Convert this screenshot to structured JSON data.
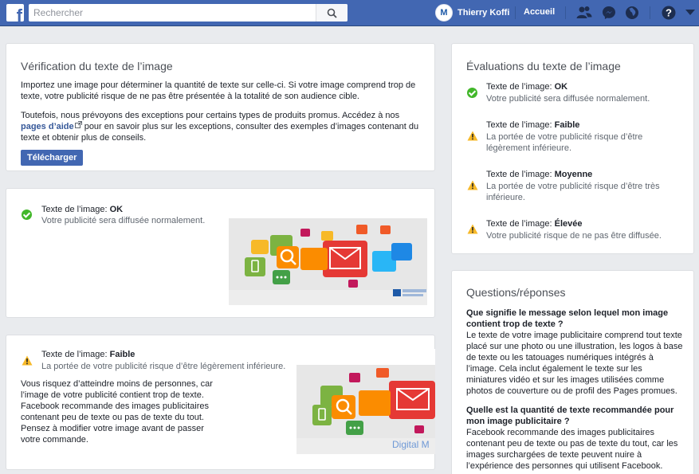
{
  "header": {
    "logo": "f",
    "search_placeholder": "Rechercher",
    "user_initial": "M",
    "user_name": "Thierry Koffi",
    "home_label": "Accueil",
    "help_label": "?"
  },
  "verification": {
    "title": "Vérification du texte de l’image",
    "paragraph1": "Importez une image pour déterminer la quantité de texte sur celle-ci. Si votre image comprend trop de texte, votre publicité risque de ne pas être présentée à la totalité de son audience cible.",
    "paragraph2_before": "Toutefois, nous prévoyons des exceptions pour certains types de produits promus. Accédez à nos ",
    "paragraph2_link": "pages d’aide",
    "paragraph2_after": " pour en savoir plus sur les exceptions, consulter des exemples d’images contenant du texte et obtenir plus de conseils.",
    "upload_button": "Télécharger"
  },
  "result1": {
    "label": "Texte de l’image:",
    "value": "OK",
    "desc": "Votre publicité sera diffusée normalement."
  },
  "result2": {
    "label": "Texte de l’image:",
    "value": "Faible",
    "desc": "La portée de votre publicité risque d’être légèrement inférieure.",
    "advice": "Vous risquez d’atteindre moins de personnes, car l’image de votre publicité contient trop de texte. Facebook recommande des images publicitaires contenant peu de texte ou pas de texte du tout. Pensez à modifier votre image avant de passer votre commande.",
    "image_caption": "Digital M"
  },
  "ratings": {
    "title": "Évaluations du texte de l’image",
    "items": [
      {
        "label": "Texte de l’image:",
        "value": "OK",
        "desc": "Votre publicité sera diffusée normalement."
      },
      {
        "label": "Texte de l’image:",
        "value": "Faible",
        "desc": "La portée de votre publicité risque d’être légèrement inférieure."
      },
      {
        "label": "Texte de l’image:",
        "value": "Moyenne",
        "desc": "La portée de votre publicité risque d’être très inférieure."
      },
      {
        "label": "Texte de l’image:",
        "value": "Élevée",
        "desc": "Votre publicité risque de ne pas être diffusée."
      }
    ]
  },
  "faq": {
    "title": "Questions/réponses",
    "items": [
      {
        "q": "Que signifie le message selon lequel mon image contient trop de texte ?",
        "a": "Le texte de votre image publicitaire comprend tout texte placé sur une photo ou une illustration, les logos à base de texte ou les tatouages numériques intégrés à l’image. Cela inclut également le texte sur les miniatures vidéo et sur les images utilisées comme photos de couverture ou de profil des Pages promues."
      },
      {
        "q": "Quelle est la quantité de texte recommandée pour mon image publicitaire ?",
        "a": "Facebook recommande des images publicitaires contenant peu de texte ou pas de texte du tout, car les images surchargées de texte peuvent nuire à l’expérience des personnes qui utilisent Facebook."
      }
    ]
  },
  "colors": {
    "brand": "#4267b2",
    "ok": "#42b72a",
    "warn": "#f7b928",
    "link": "#365899"
  }
}
